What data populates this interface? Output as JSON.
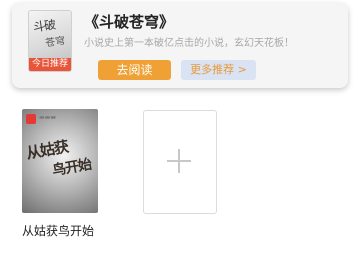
{
  "recommendation": {
    "title": "《斗破苍穹》",
    "description": "小说史上第一本破亿点击的小说，玄幻天花板！",
    "badge": "今日推荐",
    "read_button": "去阅读",
    "more_button": "更多推荐 >",
    "cover_art_text": "斗破苍穹"
  },
  "shelf": {
    "books": [
      {
        "title": "从姑获鸟开始",
        "cover_art_text": "从姑获鸟开始"
      }
    ],
    "add_icon": "plus-icon"
  },
  "colors": {
    "badge": "#e8553a",
    "read_button": "#f0a136",
    "more_button_bg": "#d9e3f3",
    "more_button_text": "#e89a3a"
  }
}
